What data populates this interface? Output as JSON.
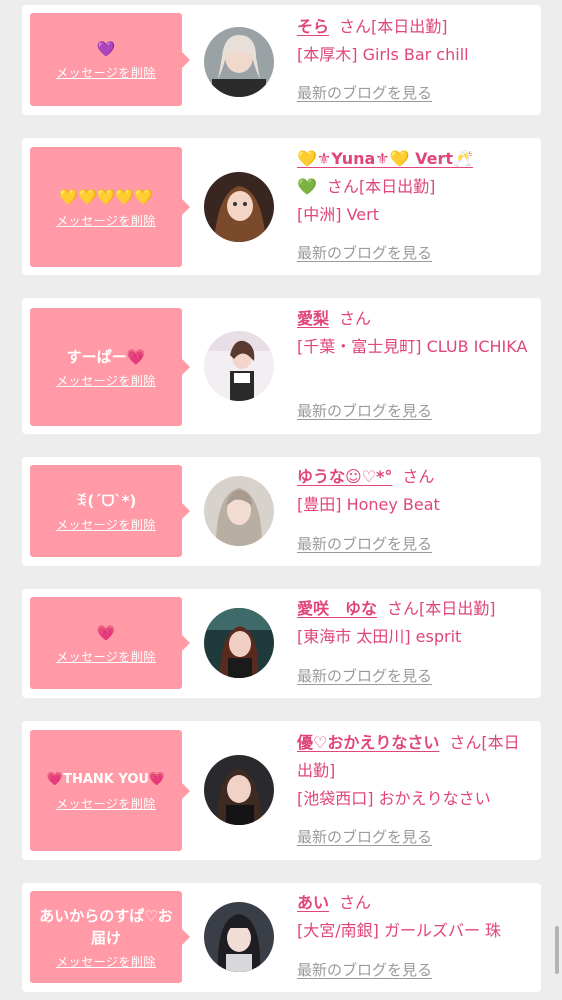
{
  "delete_label": "メッセージを削除",
  "blog_label": "最新のブログを見る",
  "san": "さん",
  "cards": [
    {
      "message": "💜",
      "name": "そら",
      "work": "[本日出勤]",
      "shop": "[本厚木] Girls Bar chill"
    },
    {
      "message": "💛💛💛💛💛",
      "name": "💛⚜Yuna⚜💛 Vert🥂",
      "name2": "💚",
      "work": "[本日出勤]",
      "shop": "[中洲] Vert"
    },
    {
      "message": "すーぱー💗",
      "name": "愛梨",
      "work": "",
      "shop": "[千葉・富士見町] CLUB ICHIKA"
    },
    {
      "message": "ꉂ(ˊᗜˋ*)",
      "name": "ゆうな☺︎♡*°",
      "work": "",
      "shop": "[豊田] Honey Beat"
    },
    {
      "message": "💗",
      "name": "愛咲　ゆな",
      "work": "[本日出勤]",
      "shop": "[東海市 太田川] esprit"
    },
    {
      "message": "💗THANK YOU💗",
      "name": "優♡おかえりなさい",
      "work": "[本日出勤]",
      "shop": "[池袋西口] おかえりなさい"
    },
    {
      "message": "あいからのすぱ♡お届け",
      "name": "あい",
      "work": "",
      "shop": "[大宮/南銀] ガールズバー 珠"
    }
  ],
  "colors": {
    "bubble": "#ff9aa6",
    "accent": "#e0457b",
    "link_gray": "#9a9a9a",
    "background": "#ededed"
  }
}
